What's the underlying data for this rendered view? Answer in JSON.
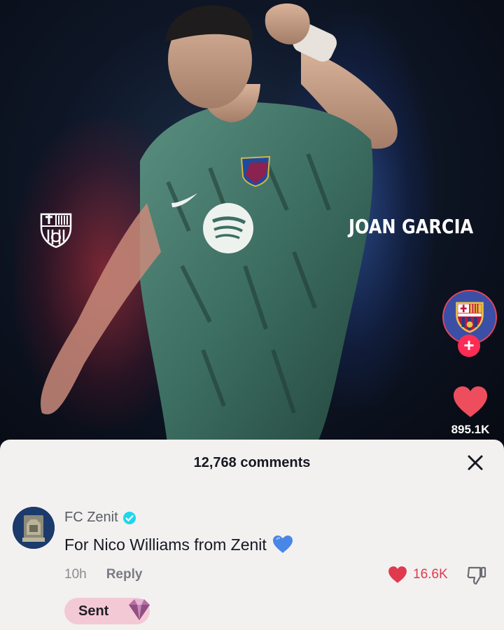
{
  "video": {
    "player_name": "JOAN GARCIA",
    "like_count": "895.1K",
    "accent_color": "#fe2c55",
    "icons": [
      "club-crest-icon",
      "heart-icon",
      "plus-icon"
    ]
  },
  "comments": {
    "title": "12,768 comments",
    "close_icon": "close-icon",
    "items": [
      {
        "username": "FC Zenit",
        "verified": true,
        "text": "For Nico Williams from Zenit",
        "emoji": "blue-heart-icon",
        "time": "10h",
        "reply_label": "Reply",
        "likes": "16.6K"
      }
    ],
    "sent_label": "Sent"
  }
}
